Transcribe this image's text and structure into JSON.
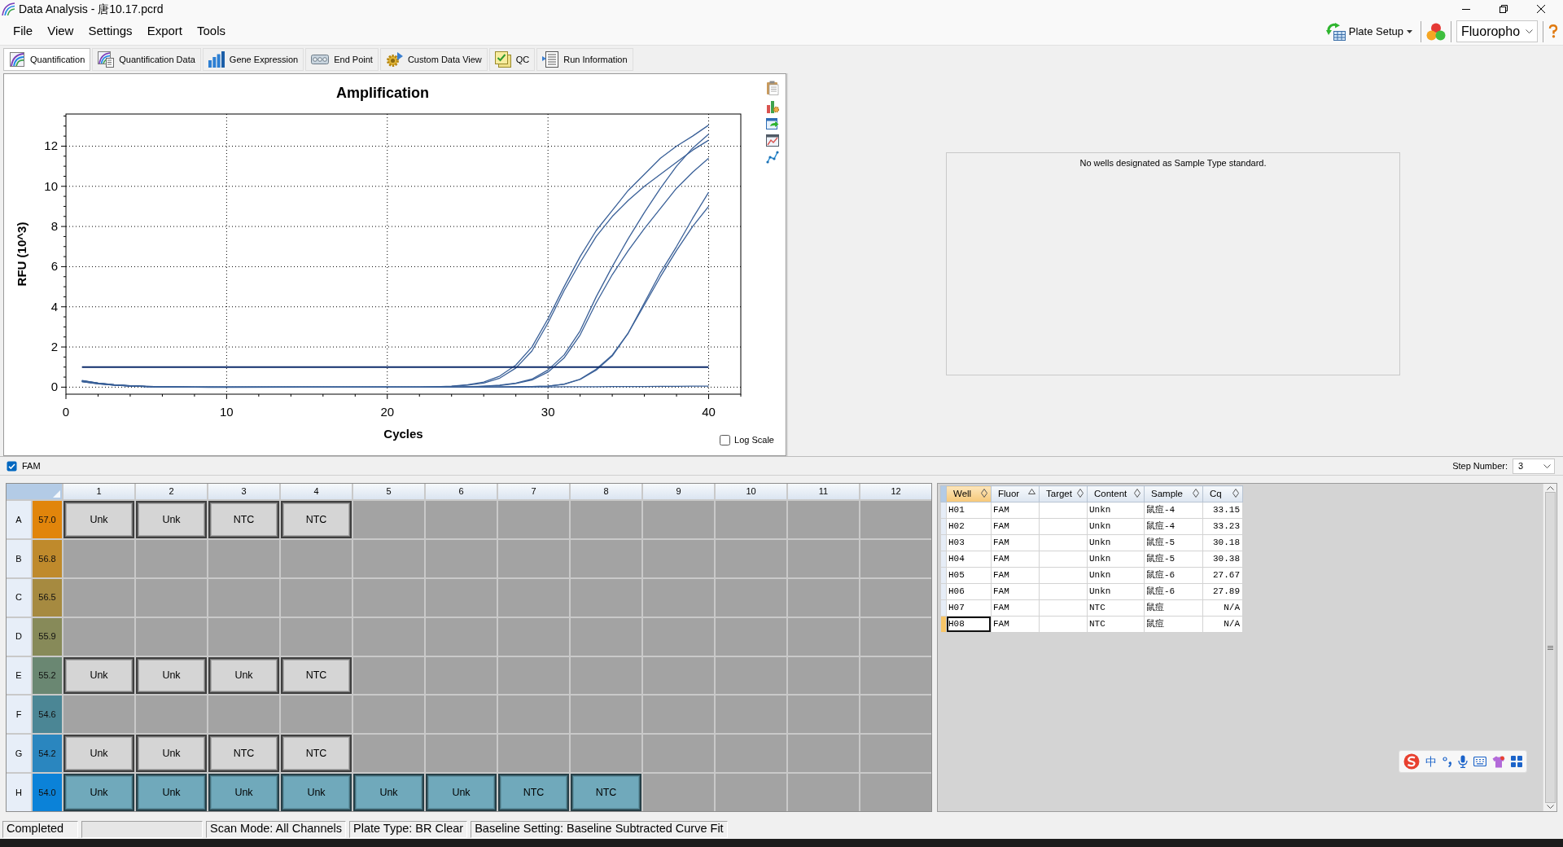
{
  "window": {
    "title": "Data Analysis - 唐10.17.pcrd"
  },
  "menu": [
    "File",
    "View",
    "Settings",
    "Export",
    "Tools"
  ],
  "toolbar_right": {
    "plate_setup": "Plate Setup",
    "fluorophore": "Fluoropho"
  },
  "tabs": [
    {
      "label": "Quantification",
      "selected": true
    },
    {
      "label": "Quantification Data",
      "selected": false
    },
    {
      "label": "Gene Expression",
      "selected": false
    },
    {
      "label": "End Point",
      "selected": false
    },
    {
      "label": "Custom Data View",
      "selected": false
    },
    {
      "label": "QC",
      "selected": false
    },
    {
      "label": "Run Information",
      "selected": false
    }
  ],
  "amplification": {
    "chart_data": {
      "type": "line",
      "title": "Amplification",
      "xlabel": "Cycles",
      "ylabel": "RFU (10^3)",
      "x": [
        1,
        2,
        3,
        4,
        5,
        6,
        8,
        10,
        15,
        20,
        22,
        23,
        24,
        25,
        26,
        27,
        28,
        29,
        30,
        31,
        32,
        33,
        34,
        35,
        36,
        37,
        38,
        39,
        40
      ],
      "series": [
        {
          "color": "#3a6098",
          "values": [
            0.32,
            0.2,
            0.12,
            0.07,
            0.04,
            0.02,
            0,
            -0.01,
            0,
            0,
            0,
            0,
            0,
            0,
            0,
            0.01,
            0.02,
            0.03,
            0.05,
            0.15,
            0.4,
            0.9,
            1.6,
            2.7,
            4.2,
            5.7,
            7.0,
            8.4,
            9.7
          ]
        },
        {
          "color": "#3a6098",
          "values": [
            0.28,
            0.17,
            0.1,
            0.06,
            0.03,
            0.01,
            0,
            0,
            0,
            0,
            0,
            0,
            0,
            0,
            0,
            0.01,
            0.02,
            0.03,
            0.05,
            0.14,
            0.38,
            0.85,
            1.55,
            2.7,
            4.1,
            5.5,
            6.8,
            8.0,
            9.0
          ]
        },
        {
          "color": "#3a6098",
          "values": [
            0.3,
            0.19,
            0.11,
            0.06,
            0.03,
            0.01,
            0,
            0,
            0,
            0,
            0,
            0,
            0,
            0.02,
            0.05,
            0.1,
            0.2,
            0.4,
            0.85,
            1.6,
            2.8,
            4.5,
            6.0,
            7.4,
            8.7,
            9.9,
            11.0,
            11.9,
            12.6
          ]
        },
        {
          "color": "#3a6098",
          "values": [
            0.27,
            0.16,
            0.1,
            0.05,
            0.03,
            0.01,
            0,
            0,
            0,
            0,
            0,
            0,
            0,
            0.01,
            0.04,
            0.08,
            0.18,
            0.35,
            0.75,
            1.45,
            2.6,
            4.2,
            5.6,
            6.8,
            7.9,
            8.9,
            9.9,
            10.7,
            11.4
          ]
        },
        {
          "color": "#3a6098",
          "values": [
            0.33,
            0.2,
            0.12,
            0.07,
            0.04,
            0.02,
            0,
            0,
            0,
            0,
            0,
            0.02,
            0.05,
            0.12,
            0.25,
            0.55,
            1.1,
            2.0,
            3.4,
            5.0,
            6.5,
            7.8,
            8.8,
            9.8,
            10.6,
            11.4,
            12.0,
            12.5,
            13.05
          ]
        },
        {
          "color": "#3a6098",
          "values": [
            0.29,
            0.18,
            0.1,
            0.06,
            0.03,
            0.01,
            0,
            0,
            0,
            0,
            0,
            0.02,
            0.04,
            0.1,
            0.2,
            0.45,
            0.95,
            1.8,
            3.2,
            4.8,
            6.2,
            7.5,
            8.5,
            9.3,
            10.0,
            10.6,
            11.2,
            11.8,
            12.3
          ]
        },
        {
          "color": "#3a6098",
          "values": [
            0.31,
            0.19,
            0.11,
            0.06,
            0.03,
            0.01,
            0,
            0,
            0,
            0,
            0,
            0,
            0,
            0,
            0,
            0,
            0,
            0.01,
            0.01,
            0.02,
            0.02,
            0.02,
            0.03,
            0.03,
            0.03,
            0.04,
            0.04,
            0.05,
            0.05
          ]
        },
        {
          "color": "#0f2d6b",
          "values": [
            1,
            1,
            1,
            1,
            1,
            1,
            1,
            1,
            1,
            1,
            1,
            1,
            1,
            1,
            1,
            1,
            1,
            1,
            1,
            1,
            1,
            1,
            1,
            1,
            1,
            1,
            1,
            1,
            1
          ]
        }
      ],
      "xlim": [
        0,
        42
      ],
      "ylim": [
        -0.35,
        13.6
      ],
      "xticks": [
        0,
        10,
        20,
        30,
        40
      ],
      "yticks": [
        0,
        2,
        4,
        6,
        8,
        10,
        12
      ],
      "grid": true
    },
    "log_scale": {
      "label": "Log Scale",
      "checked": false
    }
  },
  "standard_curve": {
    "message": "No wells designated as Sample Type standard."
  },
  "fluor_bar": {
    "fluors": [
      {
        "label": "FAM",
        "checked": true
      }
    ],
    "step_label": "Step Number:",
    "step_value": "3"
  },
  "plate": {
    "columns": [
      "1",
      "2",
      "3",
      "4",
      "5",
      "6",
      "7",
      "8",
      "9",
      "10",
      "11",
      "12"
    ],
    "rows": [
      {
        "label": "A",
        "temperature": "57.0",
        "color": "#e1850b",
        "wells": [
          {
            "content": "Unk",
            "selected": false
          },
          {
            "content": "Unk",
            "selected": false
          },
          {
            "content": "NTC",
            "selected": false
          },
          {
            "content": "NTC",
            "selected": false
          }
        ]
      },
      {
        "label": "B",
        "temperature": "56.8",
        "color": "#bf8a2c"
      },
      {
        "label": "C",
        "temperature": "56.5",
        "color": "#a68a40"
      },
      {
        "label": "D",
        "temperature": "55.9",
        "color": "#878a59"
      },
      {
        "label": "E",
        "temperature": "55.2",
        "color": "#6a8772",
        "wells": [
          {
            "content": "Unk",
            "selected": false
          },
          {
            "content": "Unk",
            "selected": false
          },
          {
            "content": "Unk",
            "selected": false
          },
          {
            "content": "NTC",
            "selected": false
          }
        ]
      },
      {
        "label": "F",
        "temperature": "54.6",
        "color": "#4b8695"
      },
      {
        "label": "G",
        "temperature": "54.2",
        "color": "#2a86bf",
        "wells": [
          {
            "content": "Unk",
            "selected": false
          },
          {
            "content": "Unk",
            "selected": false
          },
          {
            "content": "NTC",
            "selected": false
          },
          {
            "content": "NTC",
            "selected": false
          }
        ]
      },
      {
        "label": "H",
        "temperature": "54.0",
        "color": "#0b82d8",
        "wells": [
          {
            "content": "Unk",
            "selected": true
          },
          {
            "content": "Unk",
            "selected": true
          },
          {
            "content": "Unk",
            "selected": true
          },
          {
            "content": "Unk",
            "selected": true
          },
          {
            "content": "Unk",
            "selected": true
          },
          {
            "content": "Unk",
            "selected": true
          },
          {
            "content": "NTC",
            "selected": true
          },
          {
            "content": "NTC",
            "selected": true
          }
        ]
      }
    ]
  },
  "results": {
    "columns": [
      {
        "label": "Well",
        "sorted": false,
        "selected": true
      },
      {
        "label": "Fluor",
        "sorted": true,
        "selected": false
      },
      {
        "label": "Target",
        "sorted": false,
        "selected": false
      },
      {
        "label": "Content",
        "sorted": false,
        "selected": false
      },
      {
        "label": "Sample",
        "sorted": false,
        "selected": false
      },
      {
        "label": "Cq",
        "sorted": false,
        "selected": false
      }
    ],
    "rows": [
      {
        "cells": [
          "H01",
          "FAM",
          null,
          "Unkn",
          "鼠痘-4",
          "33.15"
        ],
        "selected": false
      },
      {
        "cells": [
          "H02",
          "FAM",
          null,
          "Unkn",
          "鼠痘-4",
          "33.23"
        ],
        "selected": false
      },
      {
        "cells": [
          "H03",
          "FAM",
          null,
          "Unkn",
          "鼠痘-5",
          "30.18"
        ],
        "selected": false
      },
      {
        "cells": [
          "H04",
          "FAM",
          null,
          "Unkn",
          "鼠痘-5",
          "30.38"
        ],
        "selected": false
      },
      {
        "cells": [
          "H05",
          "FAM",
          null,
          "Unkn",
          "鼠痘-6",
          "27.67"
        ],
        "selected": false
      },
      {
        "cells": [
          "H06",
          "FAM",
          null,
          "Unkn",
          "鼠痘-6",
          "27.89"
        ],
        "selected": false
      },
      {
        "cells": [
          "H07",
          "FAM",
          null,
          "NTC",
          "鼠痘",
          "N/A"
        ],
        "selected": false
      },
      {
        "cells": [
          "H08",
          "FAM",
          null,
          "NTC",
          "鼠痘",
          "N/A"
        ],
        "selected": true
      }
    ]
  },
  "status_bar": {
    "state": "Completed",
    "panels": [
      "Scan Mode: All Channels",
      "Plate Type: BR Clear",
      "Baseline Setting: Baseline Subtracted Curve Fit"
    ]
  },
  "ime_toolbar": {
    "mode": "中"
  }
}
